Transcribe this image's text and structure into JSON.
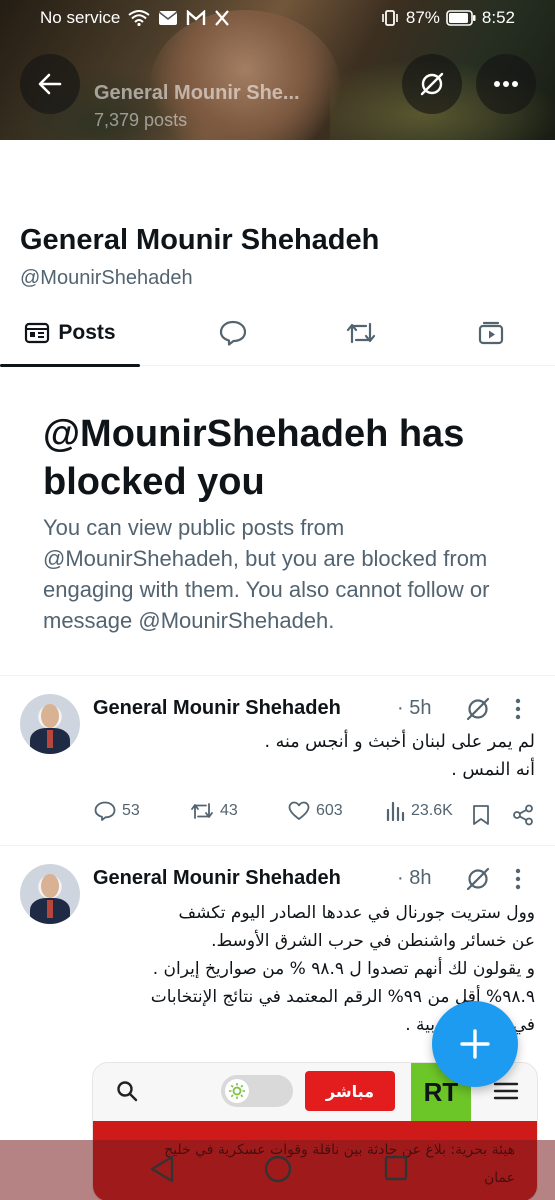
{
  "status_bar": {
    "carrier": "No service",
    "battery": "87%",
    "time": "8:52"
  },
  "header": {
    "name": "General Mounir She...",
    "post_count": "7,379 posts"
  },
  "profile": {
    "name": "General Mounir Shehadeh",
    "handle": "@MounirShehadeh"
  },
  "tabs": {
    "posts_label": "Posts"
  },
  "blocked": {
    "title": "@MounirShehadeh has blocked you",
    "message": "You can view public posts from @MounirShehadeh, but you are blocked from engaging with them. You also cannot follow or message @MounirShehadeh."
  },
  "tweets": [
    {
      "author": "General Mounir Shehadeh",
      "time": "· 5h",
      "lines": [
        "لم يمر على لبنان أخبث و أنجس منه .",
        "أنه النمس ."
      ],
      "replies": "53",
      "reposts": "43",
      "likes": "603",
      "views": "23.6K"
    },
    {
      "author": "General Mounir Shehadeh",
      "time": "· 8h",
      "lines": [
        "وول ستريت جورنال في عددها الصادر اليوم  تكشف",
        "عن خسائر واشنطن في حرب الشرق الأوسط.",
        "و يقولون لك أنهم تصدوا ل ٩٨.٩ % من صواريخ إيران .",
        "٩٨.٩% أقل من ٩٩% الرقم المعتمد في نتائج الإنتخابات",
        "في الدول العربية ."
      ]
    }
  ],
  "media": {
    "live_label": "مباشر",
    "logo_text": "RT"
  },
  "ticker": {
    "lines": [
      "هيئة بحرية: بلاغ عن حادثة بين ناقلة وقوات عسكرية في خليج",
      "عمان"
    ]
  },
  "icons": {
    "back": "arrow-left-icon",
    "grok": "grok-icon",
    "more": "more-icon",
    "compose": "plus-icon"
  },
  "colors": {
    "accent": "#1d9bf0",
    "text": "#0f1419",
    "secondary": "#536471",
    "live_red": "#e31d1d",
    "rt_green": "#6dc628"
  }
}
